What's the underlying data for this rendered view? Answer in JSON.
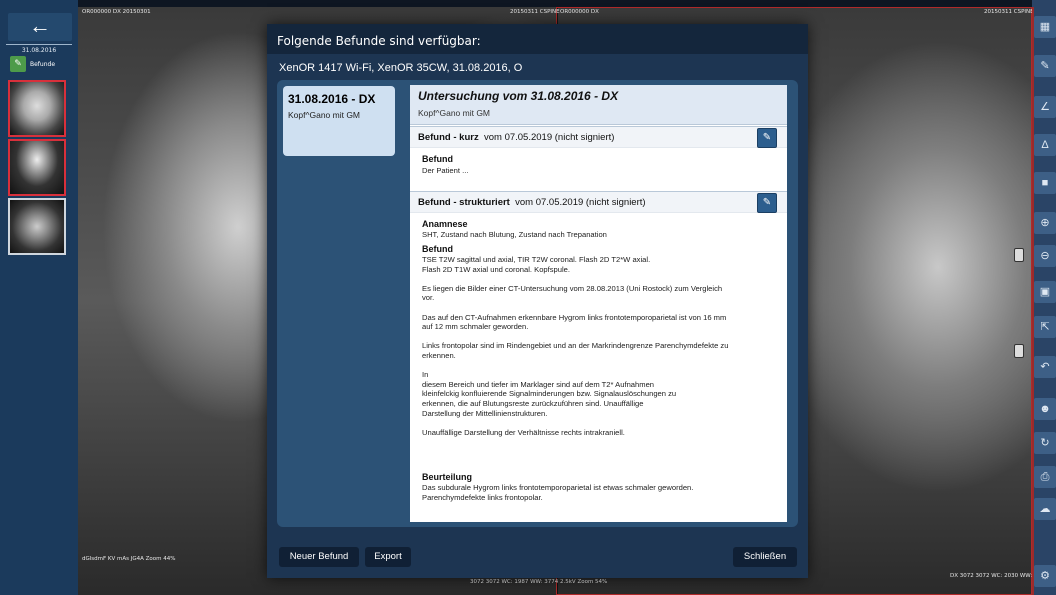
{
  "left_strip": {
    "back_icon": "arrow-left-icon",
    "date": "31.08.2016",
    "befunde_label": "Befunde"
  },
  "viewer": {
    "left_pane": {
      "top_left": "OR000000\nDX\n20150301",
      "top_right": "20150311\nCSPINE",
      "bottom_left": "dGlsdmF\nKV\nmAs\nJG4A\nZoom 44%",
      "bottom_right": "3072 3072\nWC: 1987 WW: 3774"
    },
    "right_pane": {
      "top_left": "OR000000\nDX",
      "top_right": "20150311\nCSPINE",
      "bottom_left": "2.5kV\nZoom 54%",
      "bottom_right": "DX\n3072 3072\nWC: 2030 WW: 3808"
    }
  },
  "dialog": {
    "title": "Folgende Befunde sind verfügbar:",
    "subtitle": "XenOR 1417 Wi-Fi, XenOR 35CW, 31.08.2016, O",
    "exam": {
      "date": "31.08.2016 - DX",
      "desc": "Kopf^Gano mit GM"
    },
    "report": {
      "header_title": "Untersuchung vom 31.08.2016 - DX",
      "header_sub": "Kopf^Gano mit GM",
      "short": {
        "title_bold": "Befund - kurz",
        "title_rest": "vom 07.05.2019 (nicht signiert)",
        "label": "Befund",
        "text": "Der Patient ..."
      },
      "structured": {
        "title_bold": "Befund - strukturiert",
        "title_rest": "vom 07.05.2019 (nicht signiert)",
        "anamnese_label": "Anamnese",
        "anamnese_text": "SHT, Zustand nach Blutung, Zustand nach Trepanation",
        "befund_label": "Befund",
        "befund_text": "TSE T2W sagittal und axial, TIR T2W coronal. Flash 2D T2*W axial.\nFlash 2D T1W axial und coronal. Kopfspule.\n\nEs liegen die Bilder einer CT-Untersuchung vom 28.08.2013 (Uni Rostock) zum Vergleich\nvor.\n\nDas auf den CT-Aufnahmen erkennbare Hygrom links frontotemporoparietal ist von 16 mm\nauf 12 mm schmaler geworden.\n\nLinks frontopolar sind im Rindengebiet und an der Markrindengrenze Parenchymdefekte zu\nerkennen.\n\nIn\ndiesem Bereich und tiefer im Marklager sind auf dem T2* Aufnahmen\nkleinfelckig konfluierende Signalminderungen bzw. Signalauslöschungen zu\nerkennen, die auf Blutungsreste zurückzuführen sind. Unauffällige\nDarstellung der Mittellinienstrukturen.\n\nUnauffällige Darstellung der Verhältnisse rechts intrakraniell.",
        "beurteilung_label": "Beurteilung",
        "beurteilung_text": "Das subdurale Hygrom links frontotemporoparietal ist etwas schmaler geworden.\nParenchymdefekte links frontopolar."
      }
    },
    "buttons": {
      "new": "Neuer Befund",
      "export": "Export",
      "close": "Schließen"
    }
  },
  "right_toolbar": {
    "icons": [
      "layout-icon",
      "pen-icon",
      "measure-icon",
      "angle-icon",
      "window-icon",
      "zoom-in-icon",
      "zoom-out-icon",
      "fit-icon",
      "move-icon",
      "undo-icon",
      "user-icon",
      "rotate-icon",
      "print-icon",
      "cloud-icon",
      "settings-icon"
    ]
  }
}
